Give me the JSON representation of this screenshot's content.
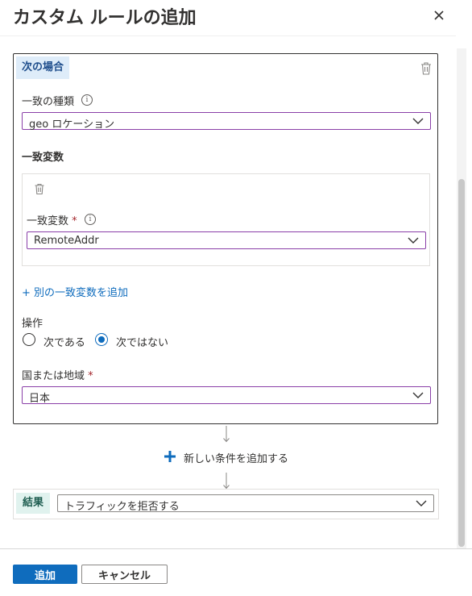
{
  "panel": {
    "title": "カスタム ルールの追加",
    "close_icon": "close-icon"
  },
  "condition": {
    "tag": "次の場合",
    "match_type_label": "一致の種類",
    "match_type_value": "geo ロケーション",
    "match_variables_heading": "一致変数",
    "variable": {
      "label": "一致変数",
      "required_mark": "*",
      "value": "RemoteAddr"
    },
    "add_variable_link": "+ 別の一致変数を追加",
    "operation_label": "操作",
    "operation_options": [
      "次である",
      "次ではない"
    ],
    "operation_selected": "次ではない",
    "country_label": "国または地域",
    "country_required_mark": "*",
    "country_value": "日本"
  },
  "add_condition_label": "新しい条件を追加する",
  "result": {
    "tag": "結果",
    "value": "トラフィックを拒否する"
  },
  "footer": {
    "add_button": "追加",
    "cancel_button": "キャンセル"
  },
  "colors": {
    "accent": "#0f6cbd",
    "select_border": "#8a3fa8",
    "required": "#a4262c",
    "condition_tag_bg": "#deecf9",
    "result_tag_bg": "#e0f2ee"
  }
}
